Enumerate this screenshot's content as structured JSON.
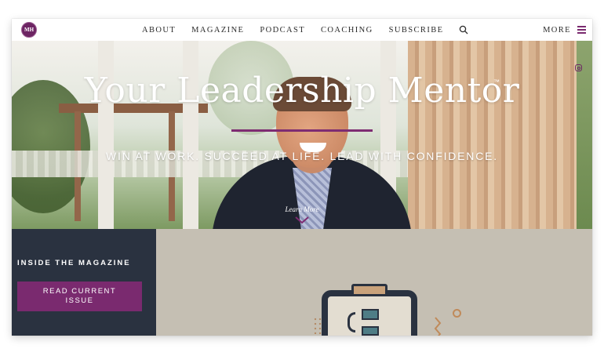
{
  "logo": {
    "text": "MH",
    "alt": "MH logo"
  },
  "nav": {
    "links": [
      "ABOUT",
      "MAGAZINE",
      "PODCAST",
      "COACHING",
      "SUBSCRIBE"
    ],
    "more_label": "MORE",
    "search_icon": "search-icon",
    "menu_icon": "hamburger-icon"
  },
  "hero": {
    "title": "Your Leadership Mentor",
    "trademark": "™",
    "tagline": "WIN AT WORK. SUCCEED AT LIFE. LEAD WITH CONFIDENCE.",
    "learn_more": "Learn More"
  },
  "social": {
    "icons": [
      "instagram-icon"
    ]
  },
  "magazine": {
    "title": "INSIDE THE MAGAZINE",
    "button_label": "READ CURRENT ISSUE"
  },
  "colors": {
    "brand_purple": "#7a2a6f",
    "dark_navy": "#2a3240",
    "beige": "#c5bfb3"
  }
}
